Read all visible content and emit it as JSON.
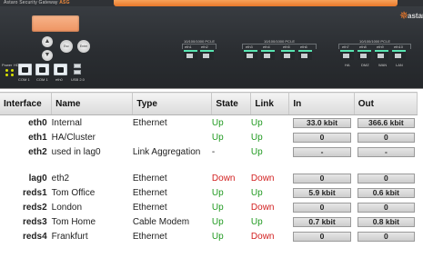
{
  "panel": {
    "title_prefix": "Astaro Security Gateway",
    "title_model": "ASG",
    "brand_name": "astar",
    "button_1": "Esc",
    "button_2": "Enter",
    "led_labels": [
      "Power",
      "HDD"
    ],
    "bottom_ports": [
      {
        "label": "COM 1",
        "kind": "serial"
      },
      {
        "label": "COM 1",
        "kind": "serial"
      },
      {
        "label": "eth0",
        "kind": "ethernet"
      },
      {
        "label": "USB 2.0",
        "kind": "usb"
      }
    ],
    "groups": [
      {
        "title": "10/100/1000 PCI-E",
        "ports": [
          "eth1",
          "eth2"
        ]
      },
      {
        "title": "10/100/1000 PCI-E",
        "ports": [
          "eth3",
          "eth4",
          "eth5",
          "eth6"
        ]
      },
      {
        "title": "10/100/1000 PCI-E",
        "ports": [
          "eth7",
          "eth8",
          "eth9",
          "eth10"
        ],
        "port_labels": [
          "HA",
          "DMZ",
          "WAN",
          "LAN"
        ]
      }
    ]
  },
  "table": {
    "headers": {
      "interface": "Interface",
      "name": "Name",
      "type": "Type",
      "state": "State",
      "link": "Link",
      "in": "In",
      "out": "Out"
    },
    "rows": [
      {
        "interface": "eth0",
        "name": "Internal",
        "type": "Ethernet",
        "state": "Up",
        "link": "Up",
        "in": "33.0 kbit",
        "out": "366.6 kbit",
        "state_status": "up",
        "link_status": "up"
      },
      {
        "interface": "eth1",
        "name": "HA/Cluster",
        "type": "",
        "state": "Up",
        "link": "Up",
        "in": "0",
        "out": "0",
        "state_status": "up",
        "link_status": "up"
      },
      {
        "interface": "eth2",
        "name": "used in lag0",
        "type": "Link Aggregation",
        "state": "-",
        "link": "Up",
        "in": "-",
        "out": "-",
        "state_status": "none",
        "link_status": "up"
      },
      {
        "interface": "lag0",
        "name": "eth2",
        "type": "Ethernet",
        "state": "Down",
        "link": "Down",
        "in": "0",
        "out": "0",
        "state_status": "down",
        "link_status": "down"
      },
      {
        "interface": "reds1",
        "name": "Tom Office",
        "type": "Ethernet",
        "state": "Up",
        "link": "Up",
        "in": "5.9 kbit",
        "out": "0.6 kbit",
        "state_status": "up",
        "link_status": "up"
      },
      {
        "interface": "reds2",
        "name": "London",
        "type": "Ethernet",
        "state": "Up",
        "link": "Down",
        "in": "0",
        "out": "0",
        "state_status": "up",
        "link_status": "down"
      },
      {
        "interface": "reds3",
        "name": "Tom Home",
        "type": "Cable Modem",
        "state": "Up",
        "link": "Up",
        "in": "0.7 kbit",
        "out": "0.8 kbit",
        "state_status": "up",
        "link_status": "up"
      },
      {
        "interface": "reds4",
        "name": "Frankfurt",
        "type": "Ethernet",
        "state": "Up",
        "link": "Down",
        "in": "0",
        "out": "0",
        "state_status": "up",
        "link_status": "down"
      }
    ]
  },
  "colors": {
    "status_up": "#219a21",
    "status_down": "#d22020",
    "accent": "#e8782a"
  }
}
